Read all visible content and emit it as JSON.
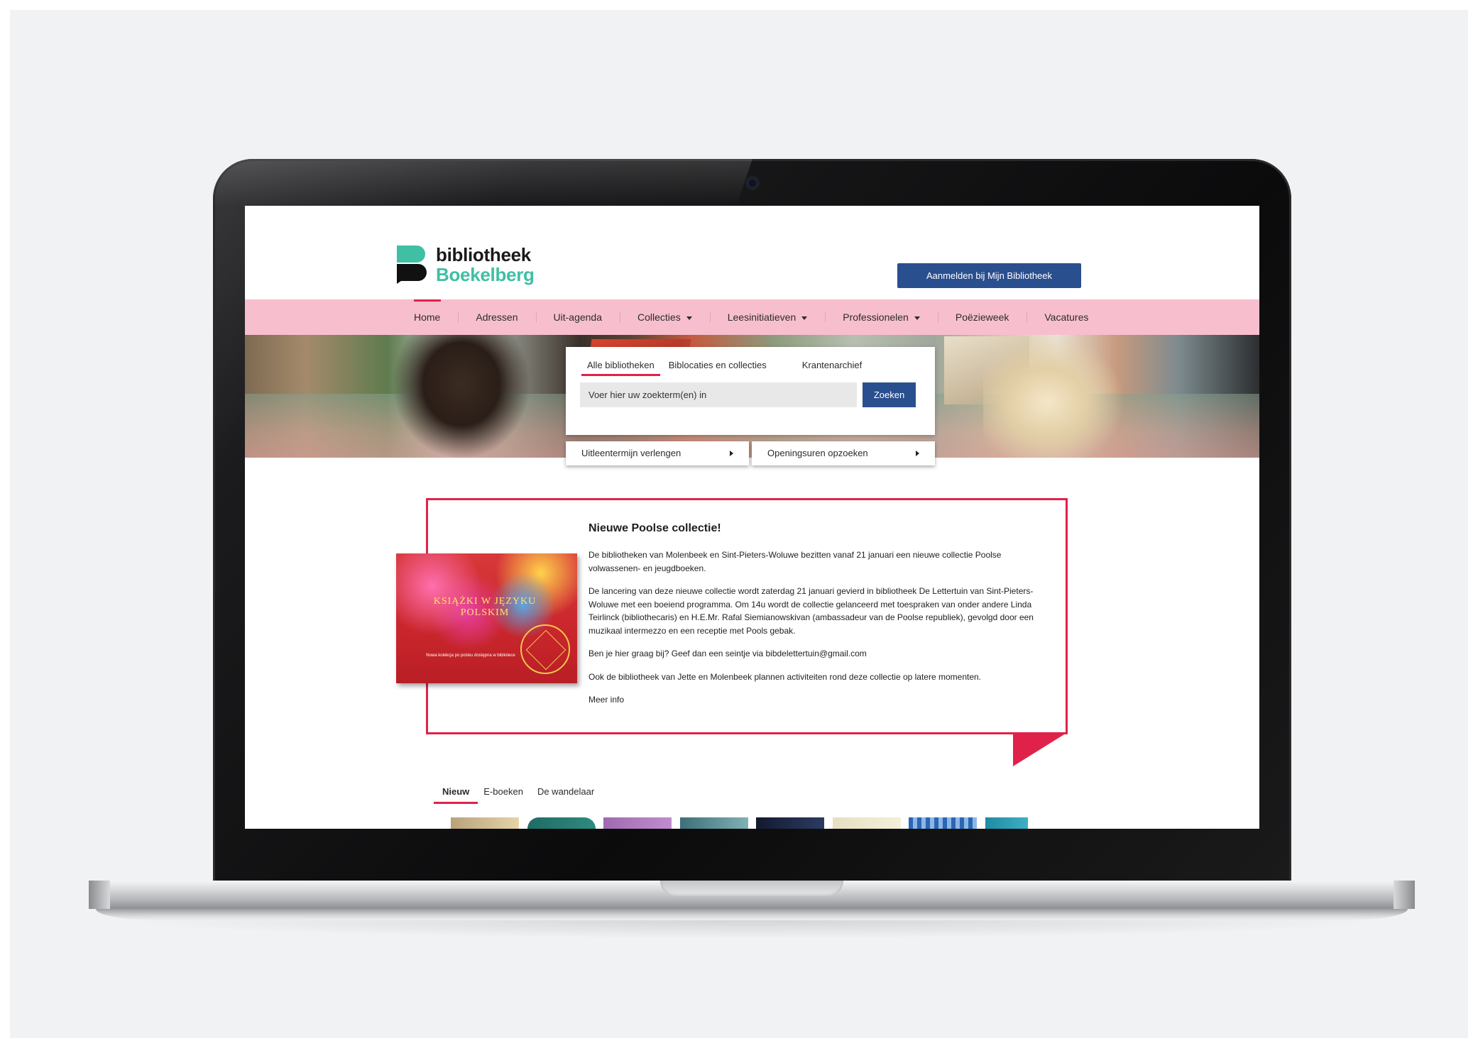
{
  "site": {
    "logo_line1": "bibliotheek",
    "logo_line2": "Boekelberg",
    "login_label": "Aanmelden bij Mijn Bibliotheek"
  },
  "nav": {
    "items": [
      {
        "label": "Home",
        "dropdown": false,
        "active": true
      },
      {
        "label": "Adressen",
        "dropdown": false
      },
      {
        "label": "Uit-agenda",
        "dropdown": false
      },
      {
        "label": "Collecties",
        "dropdown": true
      },
      {
        "label": "Leesinitiatieven",
        "dropdown": true
      },
      {
        "label": "Professionelen",
        "dropdown": true
      },
      {
        "label": "Poëzieweek",
        "dropdown": false
      },
      {
        "label": "Vacatures",
        "dropdown": false
      }
    ]
  },
  "search": {
    "tabs": [
      "Alle bibliotheken",
      "Biblocaties en collecties",
      "Krantenarchief"
    ],
    "placeholder": "Voer hier uw zoekterm(en) in",
    "button": "Zoeken"
  },
  "quick_links": [
    "Uitleentermijn verlengen",
    "Openingsuren opzoeken"
  ],
  "feature": {
    "title": "Nieuwe Poolse collectie!",
    "image_text": "KSIĄŻKI W JĘZYKU POLSKIM",
    "image_caption": "Nowa kolekcja po polsku dostępna w bibliotece",
    "paragraphs": [
      "De bibliotheken van Molenbeek en Sint-Pieters-Woluwe bezitten vanaf 21 januari een nieuwe collectie Poolse volwassenen- en jeugdboeken.",
      "De lancering van deze nieuwe collectie wordt zaterdag 21 januari gevierd in bibliotheek De Lettertuin van Sint-Pieters-Woluwe met een boeiend programma. Om 14u wordt de collectie gelanceerd met toespraken van onder andere Linda Teirlinck  (bibliothecaris) en H.E.Mr. Rafal Siemianowskivan (ambassadeur van de Poolse republiek), gevolgd door een muzikaal intermezzo en een receptie met Pools gebak.",
      "Ben je hier graag bij? Geef dan een seintje via bibdelettertuin@gmail.com",
      "Ook de bibliotheek van Jette en Molenbeek plannen activiteiten rond deze collectie op latere momenten."
    ],
    "more_link": "Meer info"
  },
  "collection_tabs": [
    {
      "label": "Nieuw",
      "active": true
    },
    {
      "label": "E-boeken"
    },
    {
      "label": "De wandelaar"
    }
  ],
  "colors": {
    "accent_red": "#e0224a",
    "nav_pink": "#f7bfcd",
    "button_blue": "#2a4f8f",
    "brand_green": "#3fbfa3"
  }
}
